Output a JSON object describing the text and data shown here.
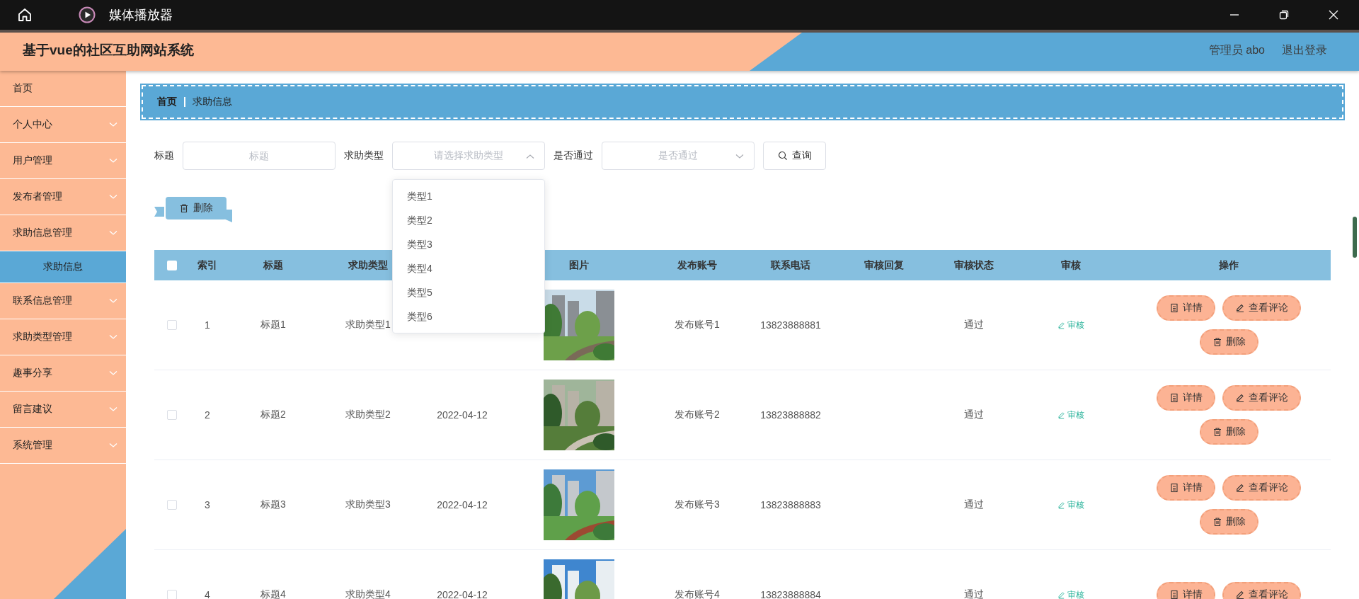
{
  "window": {
    "title": "媒体播放器"
  },
  "header": {
    "title": "基于vue的社区互助网站系统",
    "user": "管理员 abo",
    "logout": "退出登录"
  },
  "sidebar": {
    "items": [
      {
        "label": "首页",
        "submenu": false,
        "selected": false
      },
      {
        "label": "个人中心",
        "submenu": true,
        "selected": false
      },
      {
        "label": "用户管理",
        "submenu": true,
        "selected": false
      },
      {
        "label": "发布者管理",
        "submenu": true,
        "selected": false
      },
      {
        "label": "求助信息管理",
        "submenu": true,
        "selected": false,
        "children": [
          {
            "label": "求助信息",
            "selected": true
          }
        ]
      },
      {
        "label": "联系信息管理",
        "submenu": true,
        "selected": false
      },
      {
        "label": "求助类型管理",
        "submenu": true,
        "selected": false
      },
      {
        "label": "趣事分享",
        "submenu": true,
        "selected": false
      },
      {
        "label": "留言建议",
        "submenu": true,
        "selected": false
      },
      {
        "label": "系统管理",
        "submenu": true,
        "selected": false
      }
    ]
  },
  "breadcrumb": [
    "首页",
    "求助信息"
  ],
  "filters": [
    {
      "kind": "input",
      "label": "标题",
      "placeholder": "标题"
    },
    {
      "kind": "select",
      "label": "求助类型",
      "placeholder": "请选择求助类型",
      "expanded": true,
      "options": [
        {
          "label": "类型1",
          "selected": false
        },
        {
          "label": "类型2",
          "selected": false
        },
        {
          "label": "类型3",
          "selected": false
        },
        {
          "label": "类型4",
          "selected": false
        },
        {
          "label": "类型5",
          "selected": false
        },
        {
          "label": "类型6",
          "selected": false
        }
      ]
    },
    {
      "kind": "select",
      "label": "是否通过",
      "placeholder": "是否通过",
      "expanded": false
    }
  ],
  "search_button": "查询",
  "delete_button": "删除",
  "table": {
    "select_all_checked": false,
    "columns": [
      {
        "label": "索引"
      },
      {
        "label": "标题"
      },
      {
        "label": "求助类型"
      },
      {},
      {
        "label": "图片"
      },
      {
        "label": "发布账号"
      },
      {
        "label": "联系电话"
      },
      {
        "label": "审核回复"
      },
      {
        "label": "审核状态"
      },
      {
        "label": "审核"
      },
      {
        "label": "操作"
      }
    ],
    "rows": [
      {
        "checked": false,
        "index": "1",
        "title": "标题1",
        "type": "求助类型1",
        "account": "发布账号1",
        "phone": "13823888881",
        "status": "通过",
        "review": "审核",
        "actions": [
          {
            "kind": "detail",
            "label": "详情"
          },
          {
            "kind": "comment",
            "label": "查看评论"
          },
          {
            "kind": "delete",
            "label": "删除"
          }
        ]
      },
      {
        "checked": false,
        "index": "2",
        "title": "标题2",
        "type": "求助类型2",
        "date": "2022-04-12",
        "account": "发布账号2",
        "phone": "13823888882",
        "status": "通过",
        "review": "审核",
        "actions": [
          {
            "kind": "detail",
            "label": "详情"
          },
          {
            "kind": "comment",
            "label": "查看评论"
          },
          {
            "kind": "delete",
            "label": "删除"
          }
        ]
      },
      {
        "checked": false,
        "index": "3",
        "title": "标题3",
        "type": "求助类型3",
        "date": "2022-04-12",
        "account": "发布账号3",
        "phone": "13823888883",
        "status": "通过",
        "review": "审核",
        "actions": [
          {
            "kind": "detail",
            "label": "详情"
          },
          {
            "kind": "comment",
            "label": "查看评论"
          },
          {
            "kind": "delete",
            "label": "删除"
          }
        ]
      },
      {
        "checked": false,
        "index": "4",
        "title": "标题4",
        "type": "求助类型4",
        "date": "2022-04-12",
        "account": "发布账号4",
        "phone": "13823888884",
        "status": "通过",
        "review": "审核",
        "actions": [
          {
            "kind": "detail",
            "label": "详情"
          },
          {
            "kind": "comment",
            "label": "查看评论"
          }
        ]
      }
    ]
  }
}
